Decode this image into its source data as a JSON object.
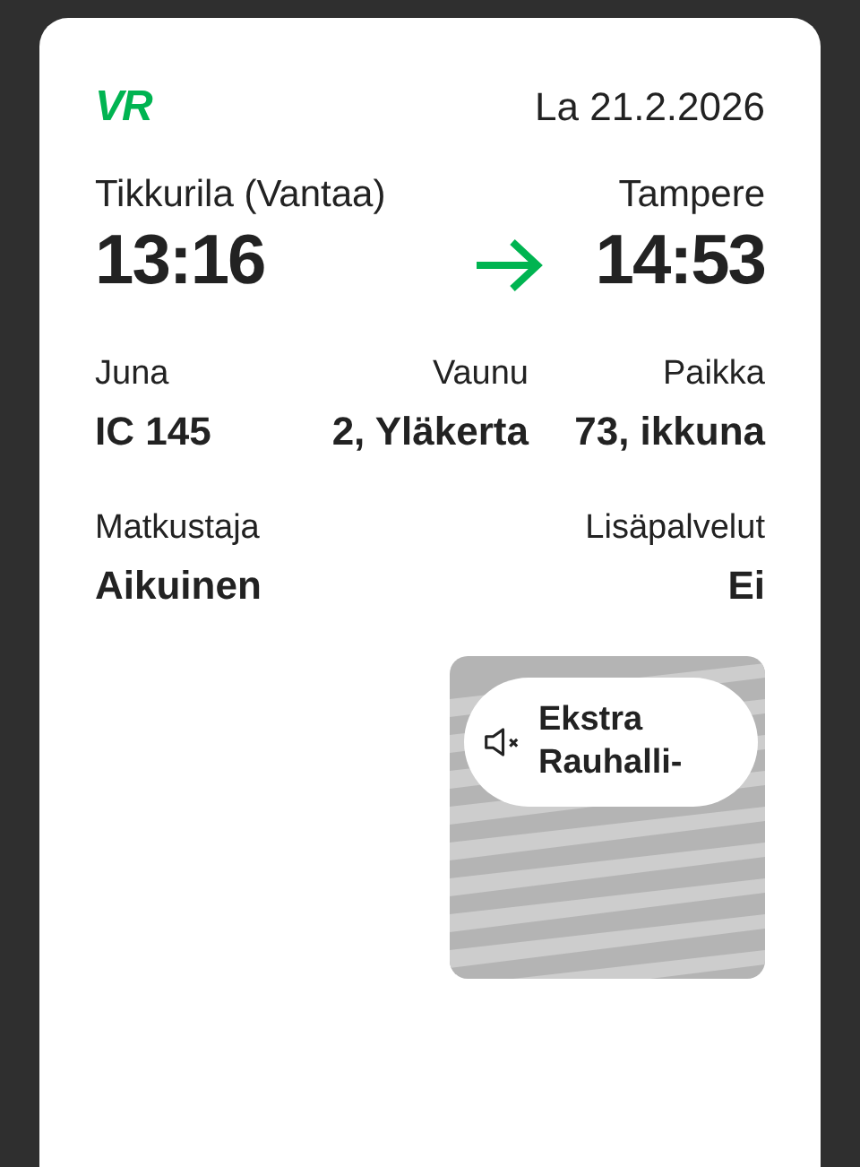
{
  "logo": "VR",
  "date": "La 21.2.2026",
  "journey": {
    "from_station": "Tikkurila (Vantaa)",
    "to_station": "Tampere",
    "departure": "13:16",
    "arrival": "14:53"
  },
  "details": [
    {
      "label": "Juna",
      "value": "IC 145"
    },
    {
      "label": "Vaunu",
      "value": "2, Yläkerta"
    },
    {
      "label": "Paikka",
      "value": "73, ikkuna"
    }
  ],
  "extras": [
    {
      "label": "Matkustaja",
      "value": "Aikuinen"
    },
    {
      "label": "Lisäpalvelut",
      "value": "Ei"
    }
  ],
  "service_badge": {
    "text": "Ekstra Rauhalli-"
  }
}
